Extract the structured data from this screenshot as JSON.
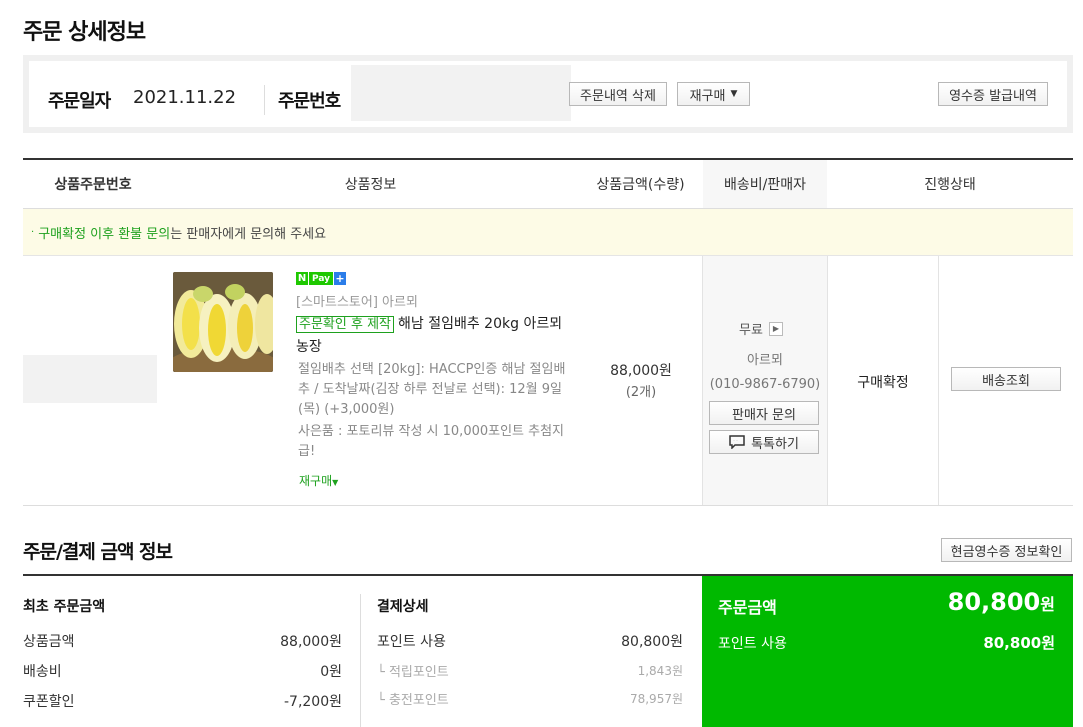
{
  "page_title": "주문 상세정보",
  "order": {
    "date_label": "주문일자",
    "date_value": "2021.11.22",
    "number_label": "주문번호",
    "delete_btn": "주문내역 삭제",
    "rebuy_btn": "재구매",
    "receipt_btn": "영수증 발급내역"
  },
  "table": {
    "headers": [
      "상품주문번호",
      "상품정보",
      "상품금액(수량)",
      "배송비/판매자",
      "진행상태"
    ],
    "notice_green": "구매확정 이후 환불 문의",
    "notice_rest": "는 판매자에게 문의해 주세요"
  },
  "item": {
    "npay_n": "N",
    "npay_pay": "Pay",
    "npay_plus": "+",
    "store": "[스마트스토어] 아르뫼",
    "tag": "주문확인 후 제작",
    "name": "해남 절임배추 20kg 아르뫼농장",
    "option": "절임배추 선택 [20kg]: HACCP인증 해남 절임배추 / 도착날짜(김장 하루 전날로 선택): 12월 9일(목) (+3,000원)",
    "gift": "사은품 : 포토리뷰 작성 시 10,000포인트 추첨지급!",
    "rebuy": "재구매",
    "price": "88,000원",
    "qty": "(2개)",
    "shipping": "무료",
    "seller": "아르뫼",
    "phone": "(010-9867-6790)",
    "inquiry_btn": "판매자 문의",
    "talk_btn": "톡톡하기",
    "status": "구매확정",
    "track_btn": "배송조회"
  },
  "summary": {
    "title": "주문/결제 금액 정보",
    "cash_receipt_btn": "현금영수증 정보확인",
    "left": {
      "heading": "최초 주문금액",
      "rows": [
        {
          "label": "상품금액",
          "value": "88,000원"
        },
        {
          "label": "배송비",
          "value": "0원"
        },
        {
          "label": "쿠폰할인",
          "value": "-7,200원"
        }
      ]
    },
    "middle": {
      "heading": "결제상세",
      "rows": [
        {
          "label": "포인트 사용",
          "value": "80,800원"
        },
        {
          "label": "└ 적립포인트",
          "value": "1,843원"
        },
        {
          "label": "└ 충전포인트",
          "value": "78,957원"
        }
      ]
    },
    "panel": {
      "title": "주문금액",
      "total": "80,800",
      "unit": "원",
      "row_label": "포인트 사용",
      "row_value": "80,800원"
    }
  },
  "colors": {
    "accent_green": "#00b900",
    "text_green": "#1ea11e",
    "notice_bg": "#fdfbe6"
  }
}
